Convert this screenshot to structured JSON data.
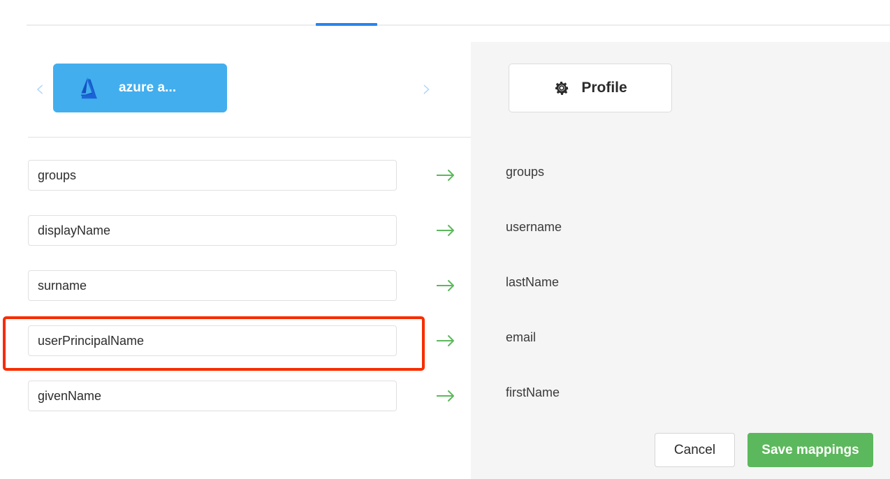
{
  "tabs": {
    "active_indicator": true,
    "accent_color": "#2684ef"
  },
  "source_app": {
    "label": "azure a...",
    "logo_icon": "azure-logo-icon",
    "tile_color": "#42aeee",
    "prev_icon": "chevron-left-icon",
    "next_icon": "chevron-right-icon"
  },
  "target_app": {
    "label": "Profile",
    "icon": "gear-icon"
  },
  "mappings": {
    "arrow_icon": "arrow-right-icon",
    "arrow_color": "#5cb85c",
    "rows": [
      {
        "source": "groups",
        "target": "groups",
        "highlighted": false
      },
      {
        "source": "displayName",
        "target": "username",
        "highlighted": false
      },
      {
        "source": "surname",
        "target": "lastName",
        "highlighted": false
      },
      {
        "source": "userPrincipalName",
        "target": "email",
        "highlighted": true
      },
      {
        "source": "givenName",
        "target": "firstName",
        "highlighted": false
      }
    ]
  },
  "highlight": {
    "color": "#f92c00"
  },
  "footer": {
    "cancel_label": "Cancel",
    "save_label": "Save mappings",
    "save_color": "#5cb85c"
  }
}
